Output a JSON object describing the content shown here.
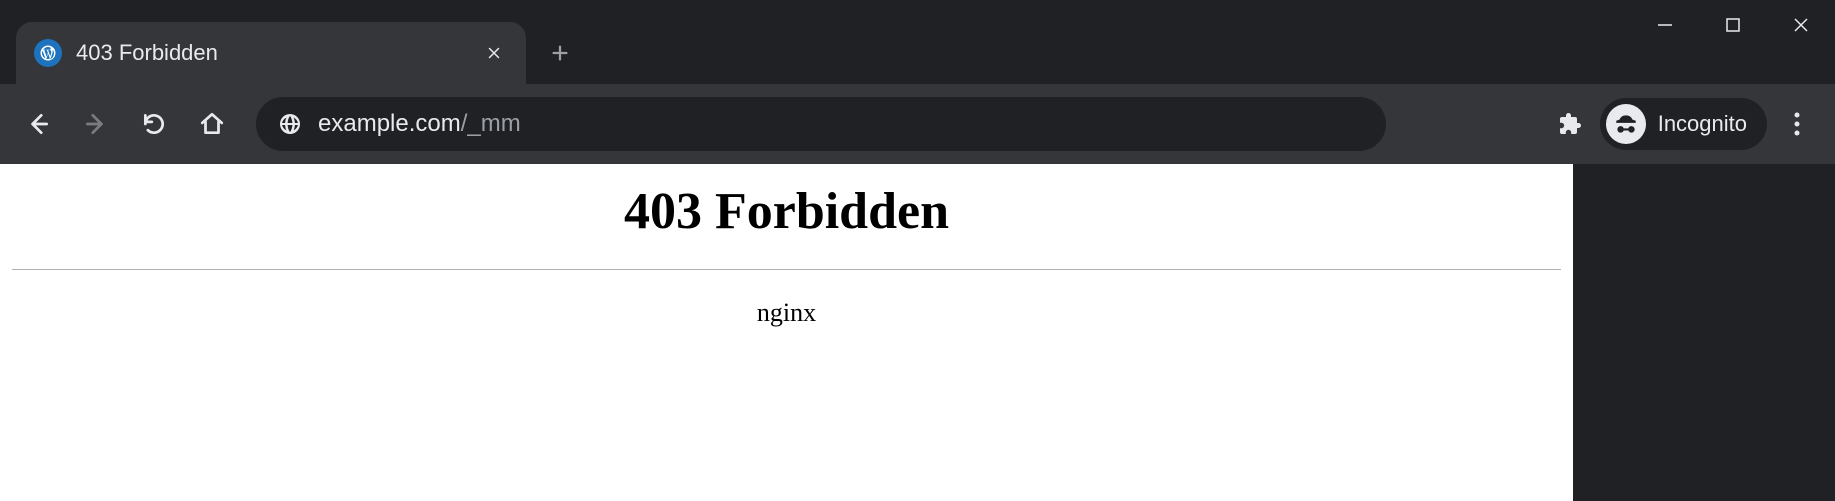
{
  "window": {
    "tab_title": "403 Forbidden"
  },
  "addressbar": {
    "host": "example.com",
    "path": "/_mm"
  },
  "incognito": {
    "label": "Incognito"
  },
  "page": {
    "heading": "403 Forbidden",
    "server": "nginx"
  }
}
